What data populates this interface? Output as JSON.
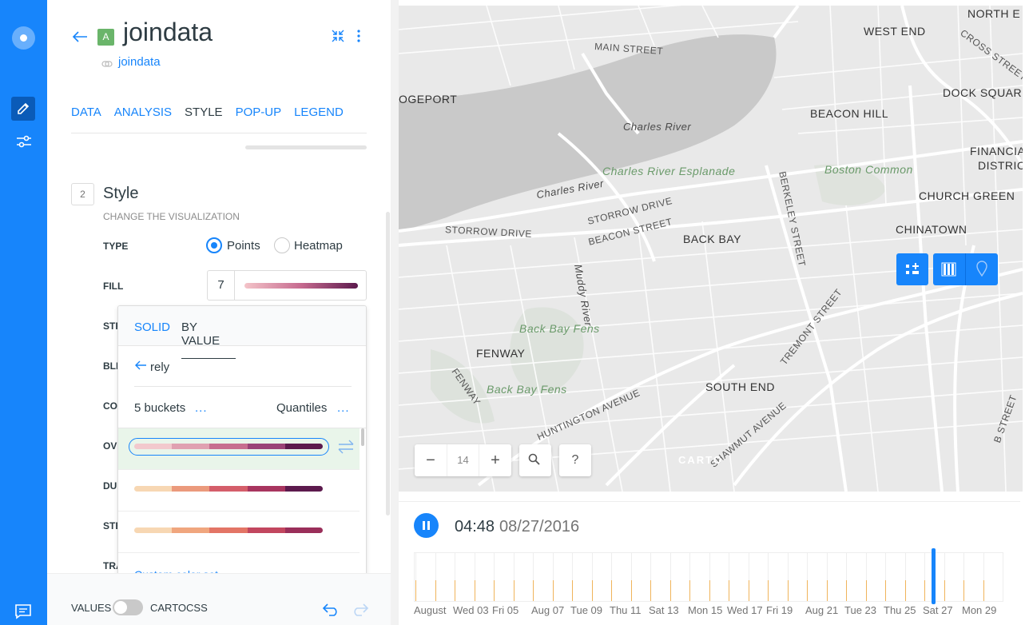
{
  "layer": {
    "badge": "A",
    "title": "joindata",
    "source": "joindata"
  },
  "tabs": [
    "DATA",
    "ANALYSIS",
    "STYLE",
    "POP-UP",
    "LEGEND"
  ],
  "style_section": {
    "step": "2",
    "title": "Style",
    "subtitle": "CHANGE THE VISUALIZATION",
    "type_label": "TYPE",
    "type_options": [
      "Points",
      "Heatmap"
    ],
    "type_selected": "Points",
    "fill_label": "FILL",
    "fill_value": "7",
    "hidden_labels": [
      "STR",
      "BLE",
      "CO",
      "OV",
      "DU",
      "STE",
      "TRA"
    ]
  },
  "color_dropdown": {
    "tab_solid": "SOLID",
    "tab_by_value": "BY VALUE",
    "field": "rely",
    "buckets": "5 buckets",
    "quantification": "Quantiles",
    "more": "...",
    "custom": "Custom color set",
    "ramps": [
      [
        "#f2c9cd",
        "#e0a1b1",
        "#c76e8f",
        "#9a4377",
        "#5c1a4d"
      ],
      [
        "#f7d7b3",
        "#eb9a7c",
        "#d45e6a",
        "#a8355f",
        "#5c1a4d"
      ],
      [
        "#f7d7b3",
        "#f0a67e",
        "#e37566",
        "#c2475f",
        "#9a2f5a"
      ]
    ]
  },
  "footer": {
    "values": "VALUES",
    "cartocss": "CARTOCSS"
  },
  "map": {
    "zoom": "14",
    "help": "?",
    "attribution": "CARTO",
    "labels": [
      {
        "t": "NORTH E",
        "c": "district"
      },
      {
        "t": "WEST END",
        "c": "district"
      },
      {
        "t": "MAIN STREET",
        "c": "street"
      },
      {
        "t": "DOCK SQUARE",
        "c": "district"
      },
      {
        "t": "OGEPORT",
        "c": "district"
      },
      {
        "t": "BEACON HILL",
        "c": "district"
      },
      {
        "t": "Charles River",
        "c": "water"
      },
      {
        "t": "FINANCIAL",
        "c": "district"
      },
      {
        "t": "DISTRICT",
        "c": "district"
      },
      {
        "t": "Charles River Esplanade",
        "c": "park"
      },
      {
        "t": "Boston Common",
        "c": "park"
      },
      {
        "t": "Charles River",
        "c": "water"
      },
      {
        "t": "CHURCH GREEN",
        "c": "district"
      },
      {
        "t": "STORROW DRIVE",
        "c": "street"
      },
      {
        "t": "BEACON STREET",
        "c": "street"
      },
      {
        "t": "CHINATOWN",
        "c": "district"
      },
      {
        "t": "STORROW DRIVE",
        "c": "street"
      },
      {
        "t": "BACK BAY",
        "c": "district"
      },
      {
        "t": "Muddy River",
        "c": "water"
      },
      {
        "t": "Back Bay Fens",
        "c": "park"
      },
      {
        "t": "FENWAY",
        "c": "district"
      },
      {
        "t": "TREMONT STREET",
        "c": "street"
      },
      {
        "t": "SOUTH END",
        "c": "district"
      },
      {
        "t": "Back Bay Fens",
        "c": "park"
      },
      {
        "t": "HUNTINGTON AVENUE",
        "c": "street"
      },
      {
        "t": "SHAWMUT AVENUE",
        "c": "street"
      },
      {
        "t": "FENWAY",
        "c": "street"
      },
      {
        "t": "BERKELEY STREET",
        "c": "street"
      },
      {
        "t": "CROSS STREET",
        "c": "street"
      },
      {
        "t": "B STREET",
        "c": "street"
      }
    ]
  },
  "timeline": {
    "time": "04:48",
    "date": "08/27/2016",
    "ticks": [
      "August",
      "Wed 03",
      "Fri 05",
      "Aug 07",
      "Tue 09",
      "Thu 11",
      "Sat 13",
      "Mon 15",
      "Wed 17",
      "Fri 19",
      "Aug 21",
      "Tue 23",
      "Thu 25",
      "Sat 27",
      "Mon 29"
    ],
    "position": 0.88
  },
  "colors": {
    "accent": "#1785fb",
    "bar": "#f0b45b"
  }
}
